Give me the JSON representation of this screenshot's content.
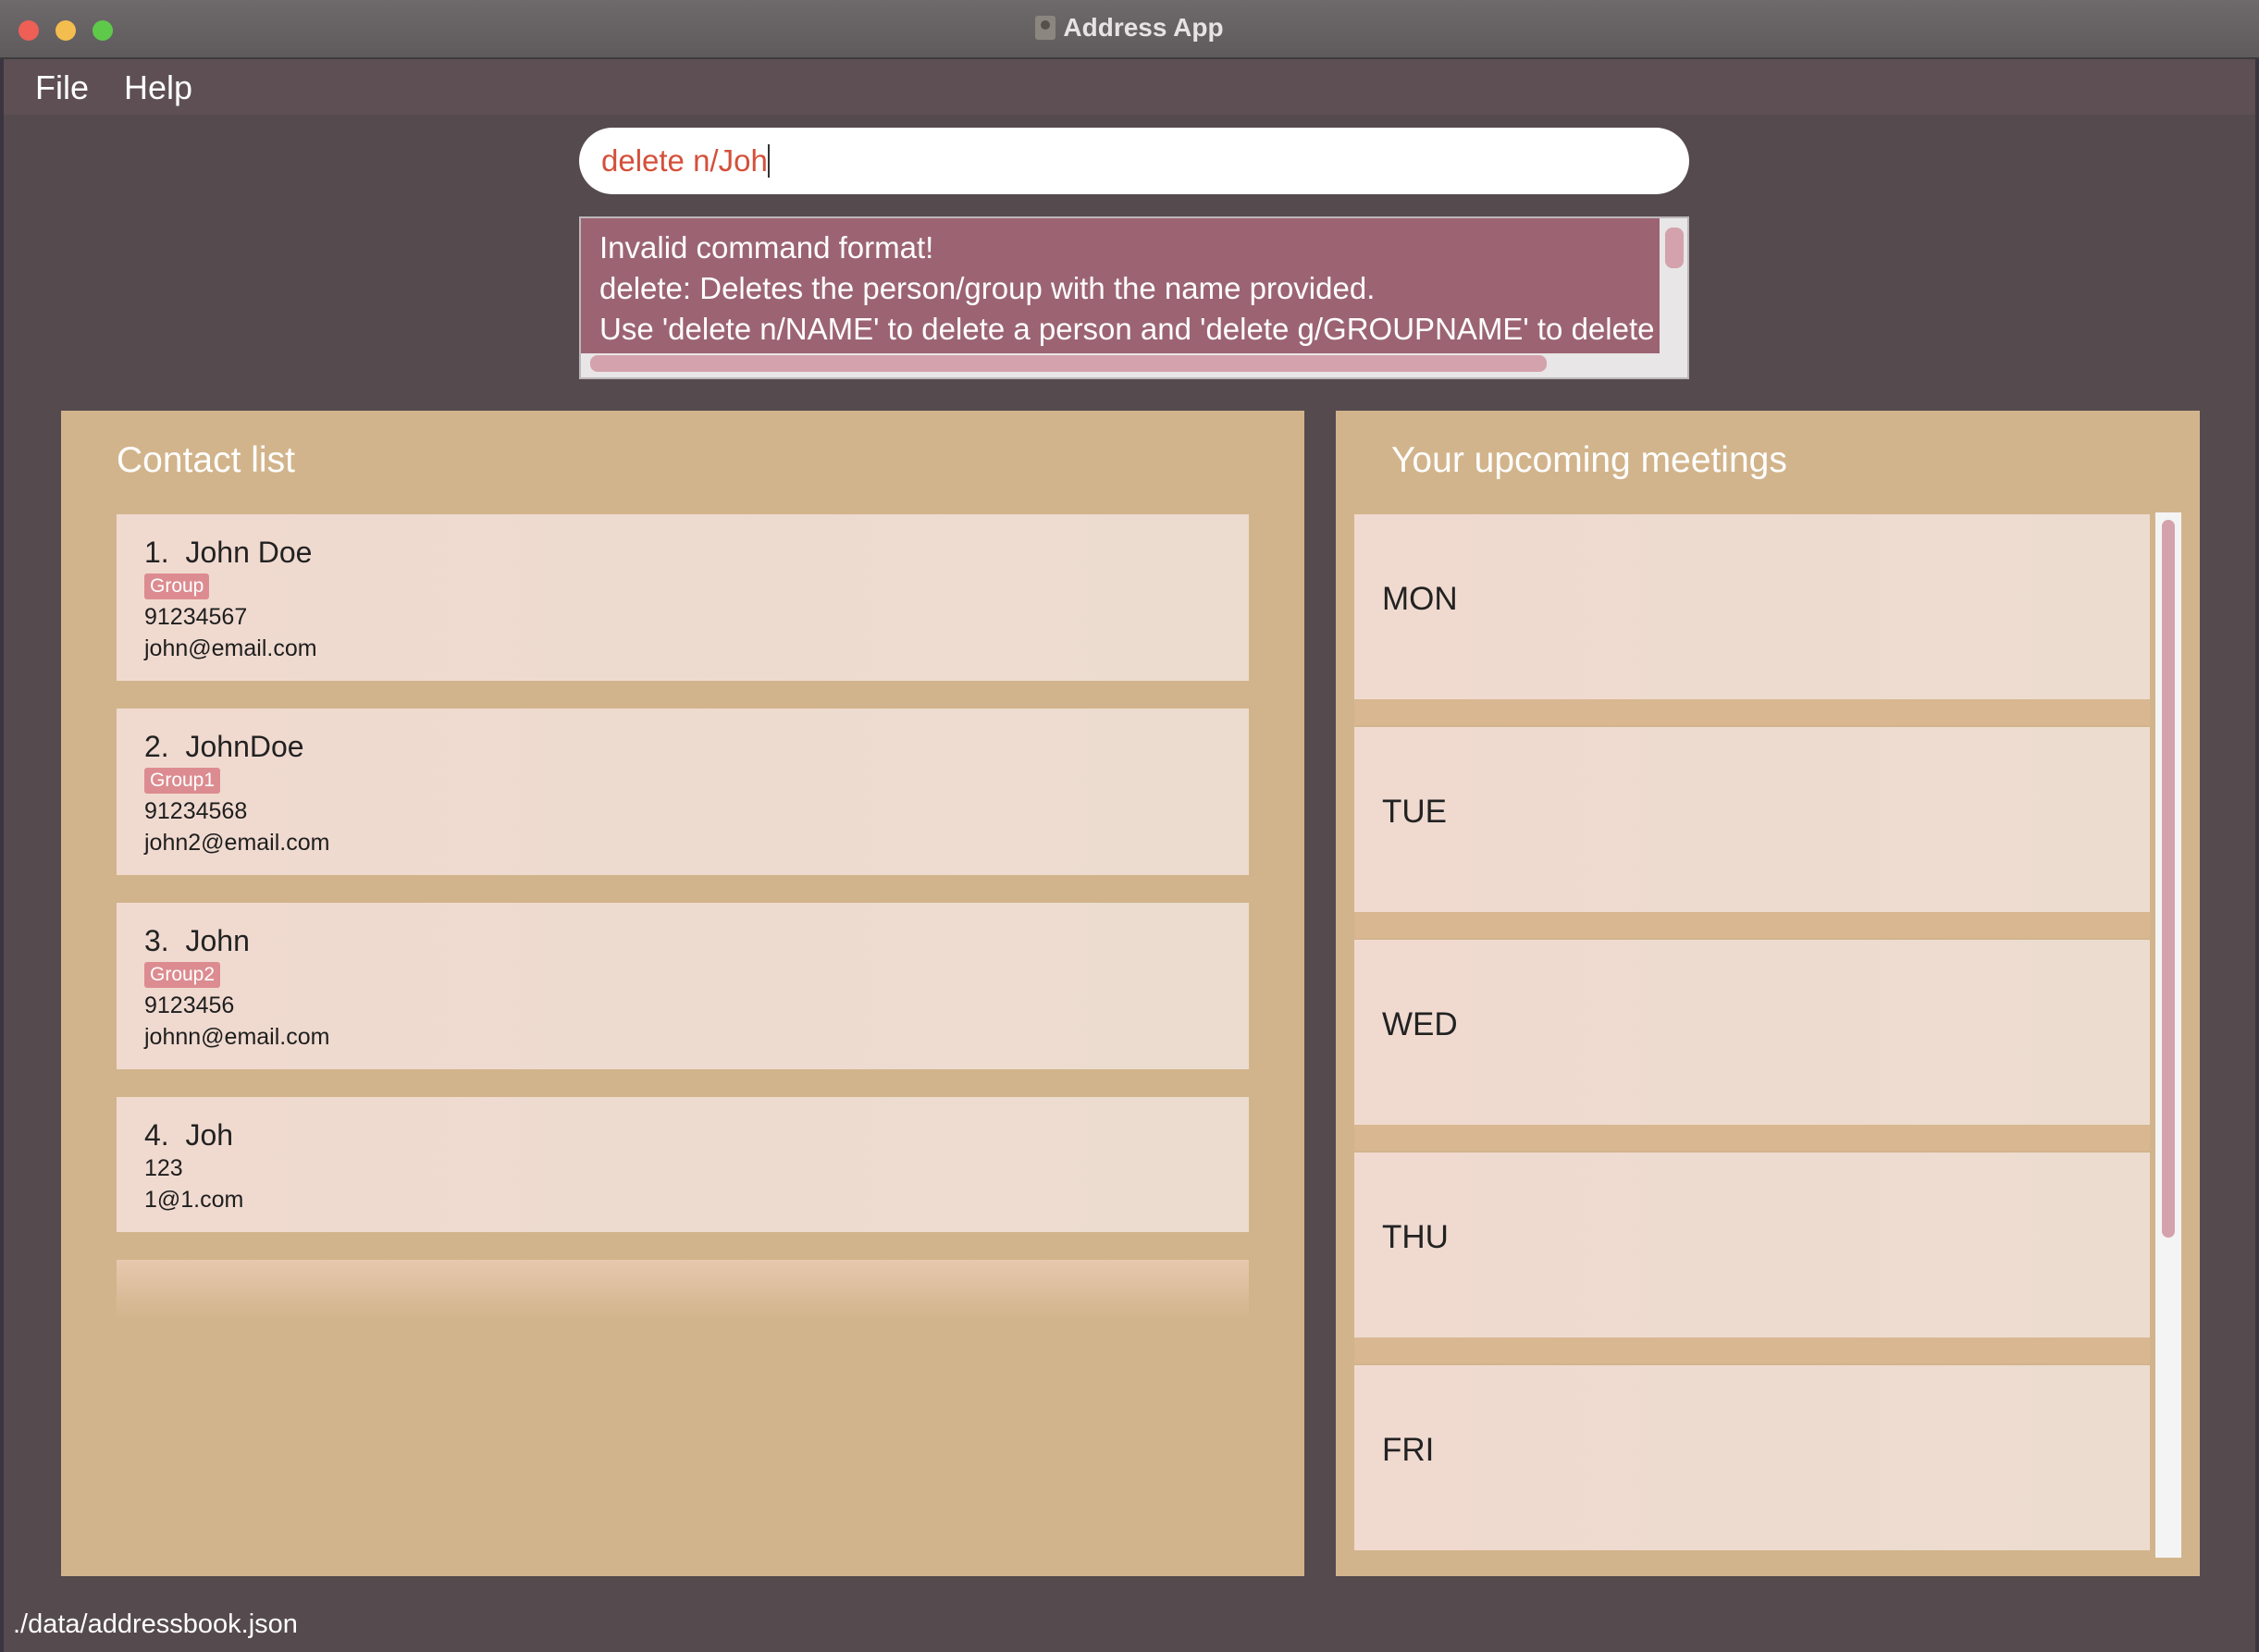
{
  "window": {
    "title": "Address App"
  },
  "menu": {
    "items": [
      "File",
      "Help"
    ]
  },
  "command": {
    "value": "delete n/Joh"
  },
  "result": {
    "lines": [
      "Invalid command format!",
      "delete: Deletes the person/group with the name provided.",
      "Use 'delete n/NAME' to delete a person and 'delete g/GROUPNAME' to delete a"
    ]
  },
  "contacts": {
    "title": "Contact list",
    "items": [
      {
        "index": "1.",
        "name": "John Doe",
        "tag": "Group",
        "phone": "91234567",
        "email": "john@email.com"
      },
      {
        "index": "2.",
        "name": "JohnDoe",
        "tag": "Group1",
        "phone": "91234568",
        "email": "john2@email.com"
      },
      {
        "index": "3.",
        "name": "John",
        "tag": "Group2",
        "phone": "9123456",
        "email": "johnn@email.com"
      },
      {
        "index": "4.",
        "name": "Joh",
        "tag": "",
        "phone": "123",
        "email": "1@1.com"
      }
    ]
  },
  "meetings": {
    "title": "Your upcoming meetings",
    "days": [
      "MON",
      "TUE",
      "WED",
      "THU",
      "FRI"
    ]
  },
  "status": {
    "path": "./data/addressbook.json"
  },
  "colors": {
    "background": "#554a4e",
    "panel": "#d2b48c",
    "card": "#f0dad0",
    "tag": "#dc8c90",
    "result_bg": "#9c6473",
    "command_text": "#d4503a"
  }
}
